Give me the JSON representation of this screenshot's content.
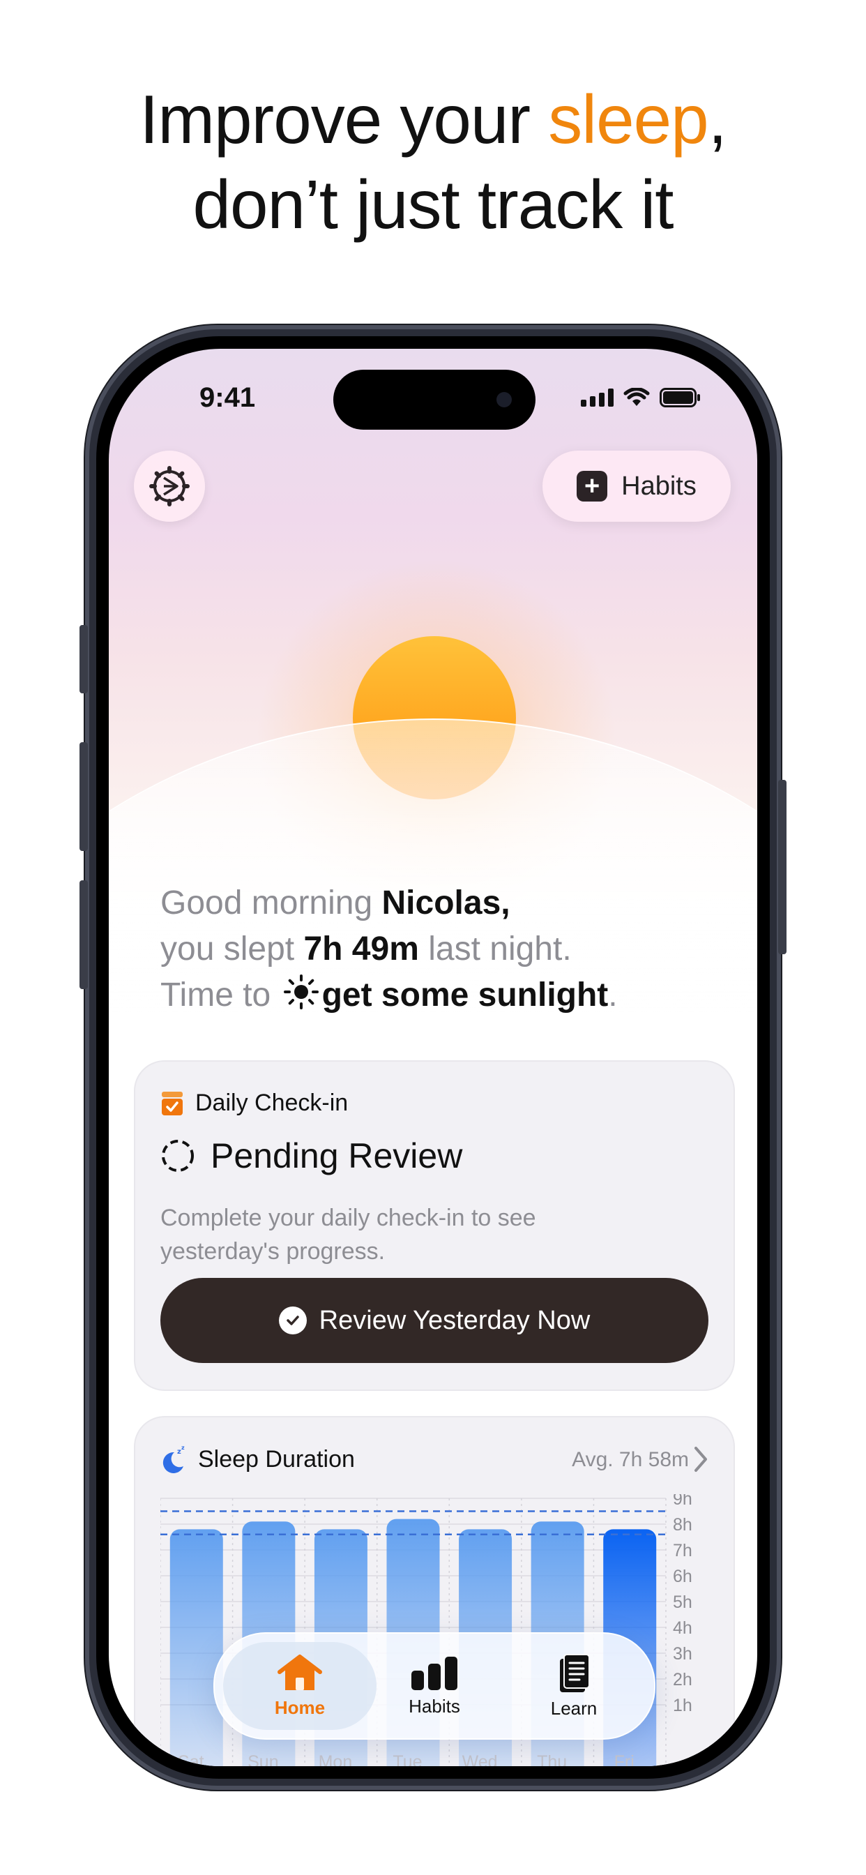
{
  "headline": {
    "pre": "Improve your ",
    "accent": "sleep",
    "post": ",",
    "line2": "don’t just track it"
  },
  "colors": {
    "accent": "#f0860d",
    "button_dark": "#322826",
    "bar_blue": "#5a9cf0",
    "bar_blue_today": "#0a63f2"
  },
  "status_bar": {
    "time": "9:41"
  },
  "top": {
    "settings_icon": "gear-icon",
    "habits_label": "Habits"
  },
  "greeting": {
    "line1_pre": "Good morning ",
    "name": "Nicolas,",
    "line2_pre": "you slept ",
    "duration": "7h 49m",
    "line2_post": " last night.",
    "line3_pre": "Time to ",
    "action": "get some sunlight",
    "line3_post": "."
  },
  "checkin": {
    "title": "Daily Check-in",
    "status": "Pending Review",
    "description": "Complete your daily check-in to see yesterday's progress.",
    "button_label": "Review Yesterday Now"
  },
  "sleep_duration": {
    "title": "Sleep Duration",
    "average": "Avg. 7h 58m"
  },
  "chart_data": {
    "type": "bar",
    "categories": [
      "Sat",
      "Sun",
      "Mon",
      "Tue",
      "Wed",
      "Thu",
      "Fri"
    ],
    "values": [
      7.8,
      8.1,
      7.8,
      8.2,
      7.8,
      8.1,
      7.8
    ],
    "y_ticks": [
      "9h",
      "8h",
      "7h",
      "6h",
      "5h",
      "4h",
      "3h",
      "2h",
      "1h"
    ],
    "ylim": [
      0,
      9
    ],
    "reference_lines": [
      8.5,
      7.6
    ],
    "grid": true
  },
  "tabbar": {
    "home": "Home",
    "habits": "Habits",
    "learn": "Learn"
  }
}
